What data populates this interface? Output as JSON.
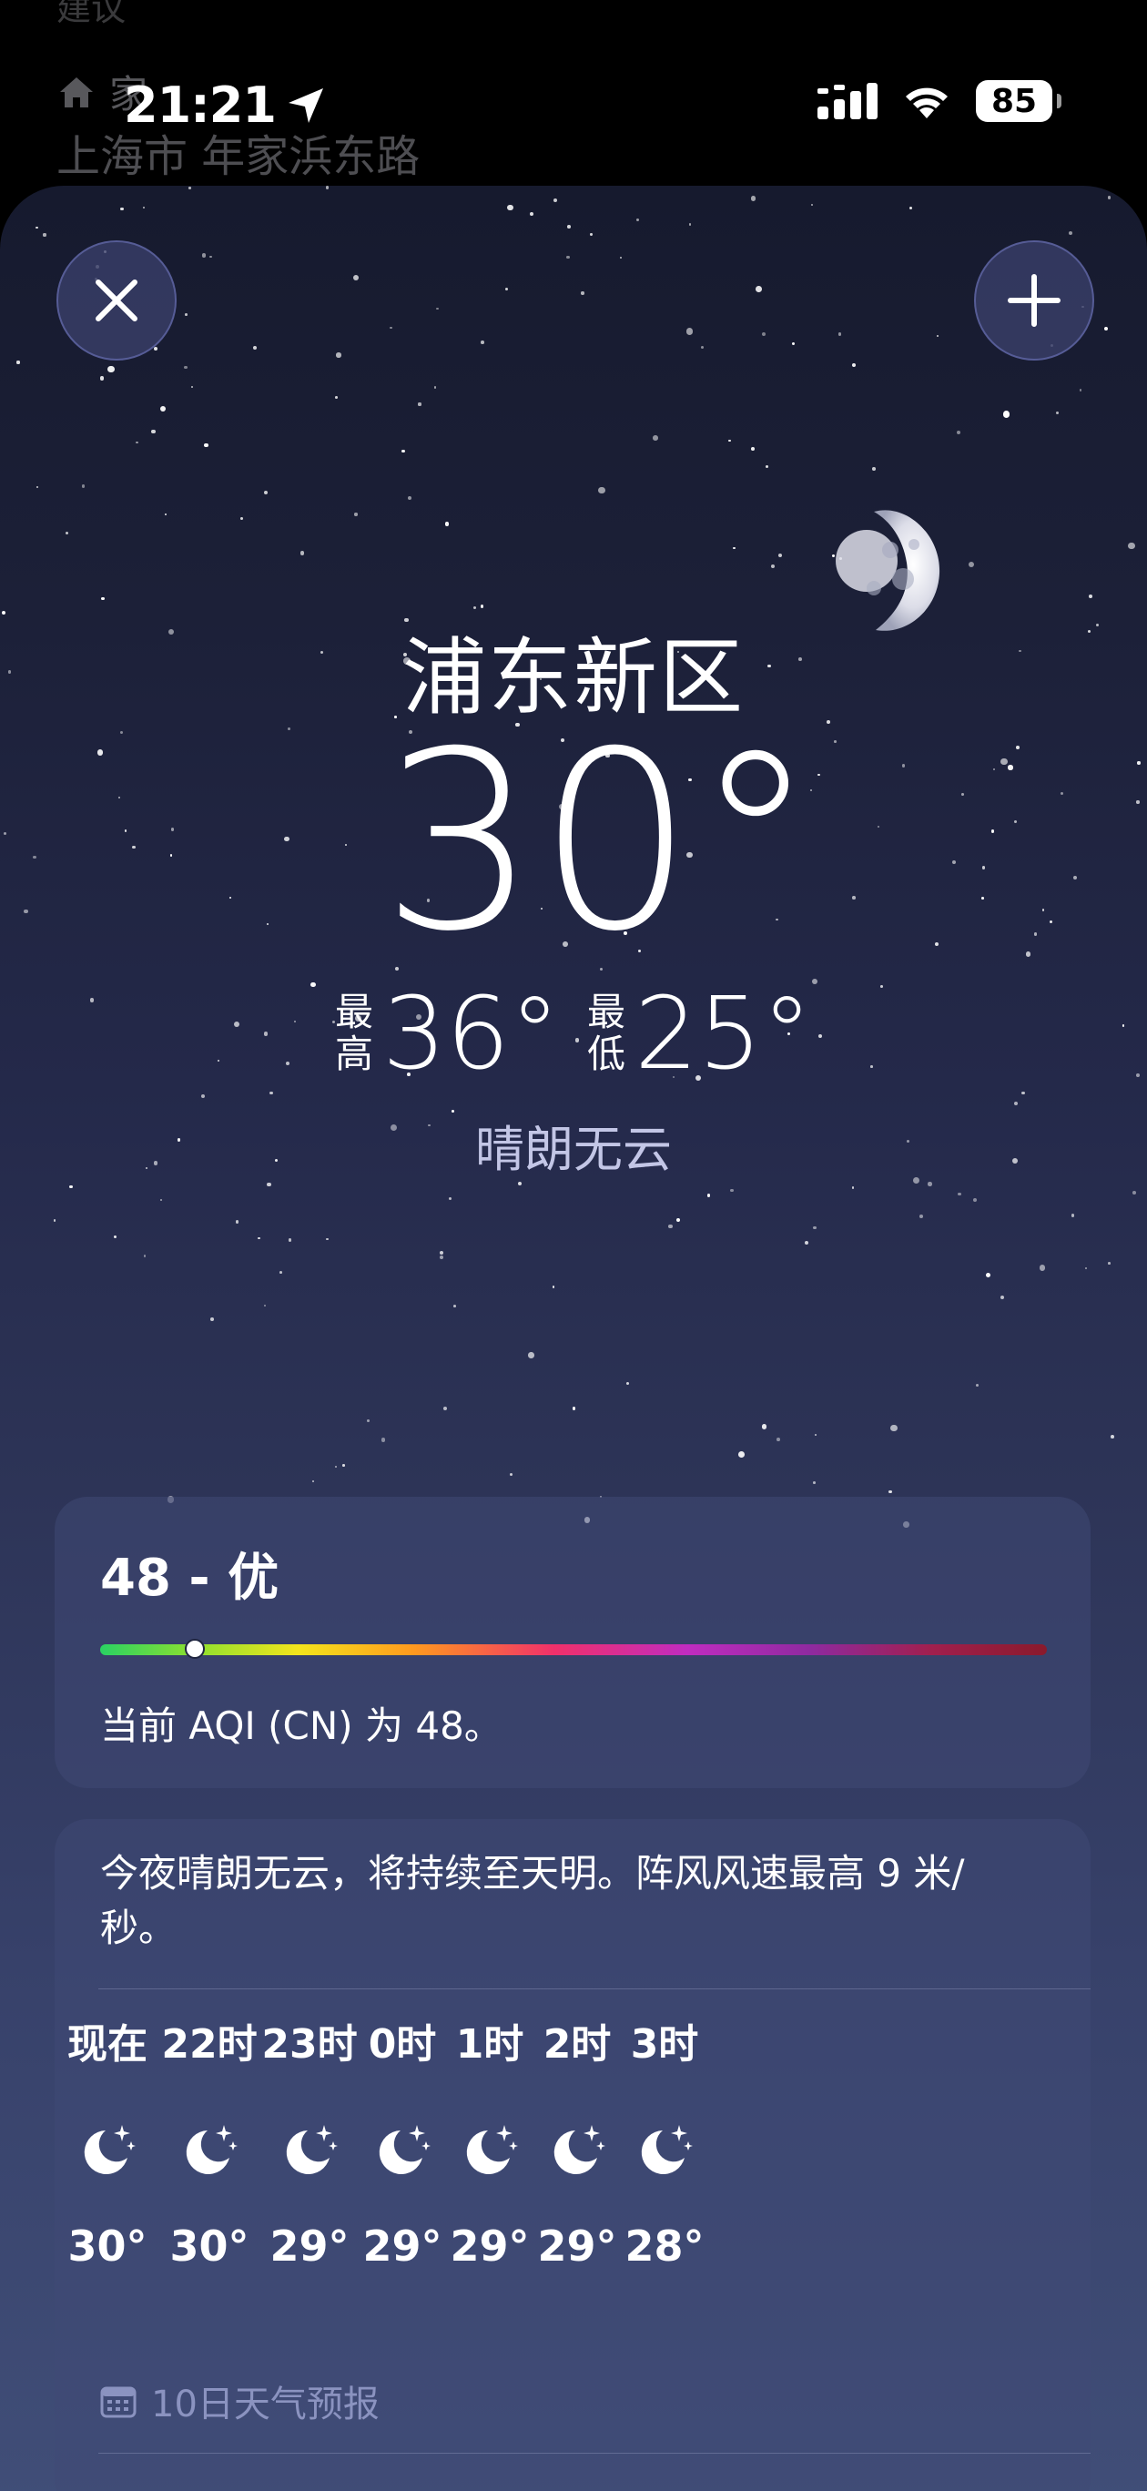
{
  "background_sheet": {
    "suggestions_label": "建议",
    "home_label": "家",
    "home_icon": "house-icon",
    "address": "上海市 年家浜东路"
  },
  "status_bar": {
    "time": "21:21",
    "location_icon": "location-arrow-icon",
    "signal_icon": "cellular-signal-icon",
    "wifi_icon": "wifi-icon",
    "battery_level": "85"
  },
  "weather": {
    "close_icon": "close-icon",
    "add_icon": "plus-icon",
    "city": "浦东新区",
    "current_temp": "30°",
    "high_label": "最高",
    "high_temp": "36°",
    "low_label": "最低",
    "low_temp": "25°",
    "condition": "晴朗无云"
  },
  "aqi": {
    "title": "48 - 优",
    "description": "当前 AQI (CN) 为 48。",
    "value": 48,
    "scale_fraction": 0.1
  },
  "hourly": {
    "summary": "今夜晴朗无云，将持续至天明。阵风风速最高 9 米/秒。",
    "items": [
      {
        "label": "现在",
        "icon": "moon-stars-icon",
        "temp": "30°"
      },
      {
        "label": "22时",
        "icon": "moon-stars-icon",
        "temp": "30°"
      },
      {
        "label": "23时",
        "icon": "moon-stars-icon",
        "temp": "29°"
      },
      {
        "label": "0时",
        "icon": "moon-stars-icon",
        "temp": "29°"
      },
      {
        "label": "1时",
        "icon": "moon-stars-icon",
        "temp": "29°"
      },
      {
        "label": "2时",
        "icon": "moon-stars-icon",
        "temp": "29°"
      },
      {
        "label": "3时",
        "icon": "moon-stars-icon",
        "temp": "28°"
      }
    ]
  },
  "ten_day": {
    "icon": "calendar-icon",
    "label": "10日天气预报"
  },
  "colors": {
    "sky_top": "#161a2e",
    "sky_bottom": "#414f79",
    "condition_text": "#c3c6e6",
    "ten_day_label": "#8b93c0"
  }
}
